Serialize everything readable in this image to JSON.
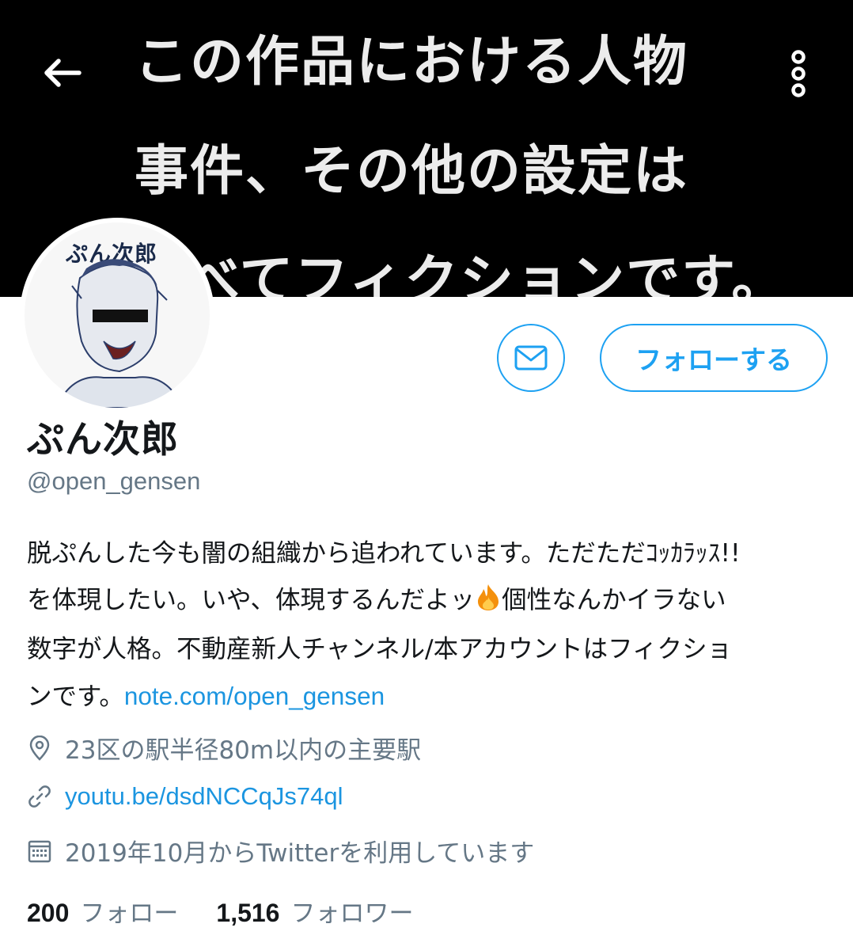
{
  "banner": {
    "line1": "この作品における人物",
    "line2": "事件、その他の設定は",
    "line3": "すべてフィクションです。"
  },
  "nav": {
    "back_icon": "arrow-left-icon",
    "more_icon": "more-vertical-icon"
  },
  "avatar": {
    "label": "ぷん次郎"
  },
  "actions": {
    "message_icon": "mail-icon",
    "follow_label": "フォローする",
    "accent": "#1da1f2"
  },
  "profile": {
    "name": "ぷん次郎",
    "handle": "@open_gensen",
    "bio": {
      "line1": "脱ぷんした今も闇の組織から追われています。ただただｺｯｶﾗｯｽ!!",
      "line2a": "を体現したい。いや、体現するんだよッ",
      "fire_icon": "fire-emoji-icon",
      "line2b": "個性なんかイラない",
      "line3": "数字が人格。不動産新人チャンネル/本アカウントはフィクショ",
      "line4": "ンです。",
      "link": "note.com/open_gensen"
    },
    "location": "23区の駅半径80m以内の主要駅",
    "url": "youtu.be/dsdNCCqJs74ql",
    "joined": "2019年10月からTwitterを利用しています"
  },
  "stats": {
    "following_count": "200",
    "following_label": "フォロー",
    "followers_count": "1,516",
    "followers_label": "フォロワー"
  }
}
